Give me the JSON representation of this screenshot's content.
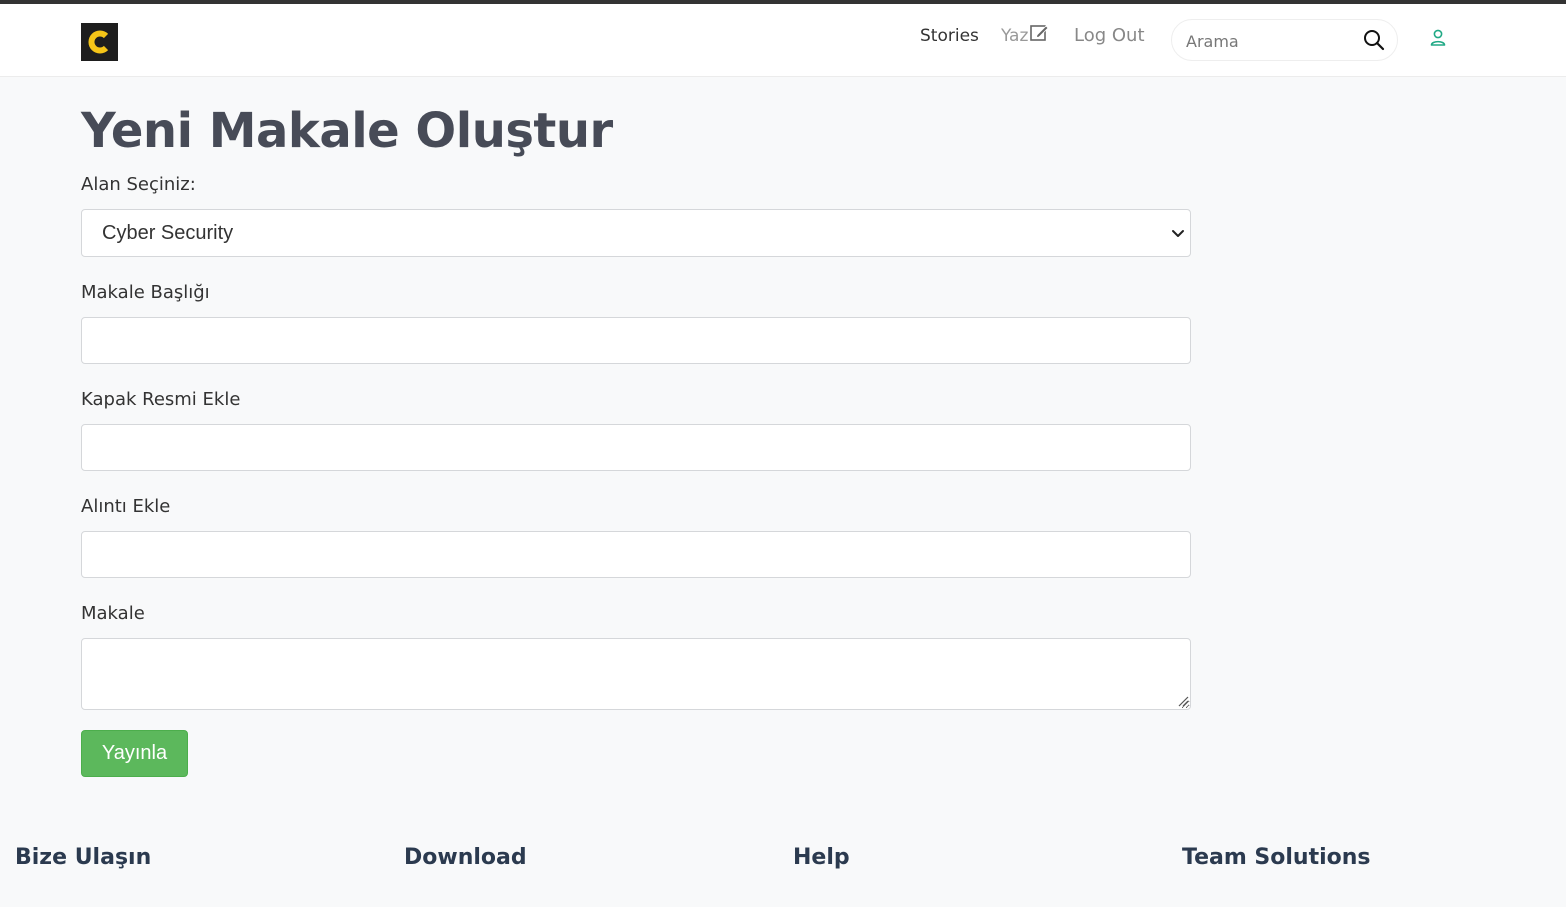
{
  "navbar": {
    "logo_letter": "C",
    "links": {
      "stories": "Stories",
      "write": "Yaz",
      "logout": "Log Out"
    },
    "search": {
      "placeholder": "Arama",
      "value": ""
    }
  },
  "form": {
    "title": "Yeni Makale Oluştur",
    "category": {
      "label": "Alan Seçiniz:",
      "selected": "Cyber Security"
    },
    "article_title": {
      "label": "Makale Başlığı",
      "value": ""
    },
    "cover_image": {
      "label": "Kapak Resmi Ekle",
      "value": ""
    },
    "quote": {
      "label": "Alıntı Ekle",
      "value": ""
    },
    "article": {
      "label": "Makale",
      "value": ""
    },
    "submit_label": "Yayınla"
  },
  "footer": {
    "headings": [
      "Bize Ulaşın",
      "Download",
      "Help",
      "Team Solutions"
    ]
  },
  "colors": {
    "accent_green": "#5cb85c",
    "logo_yellow": "#f5c518",
    "user_icon": "#20a985"
  }
}
